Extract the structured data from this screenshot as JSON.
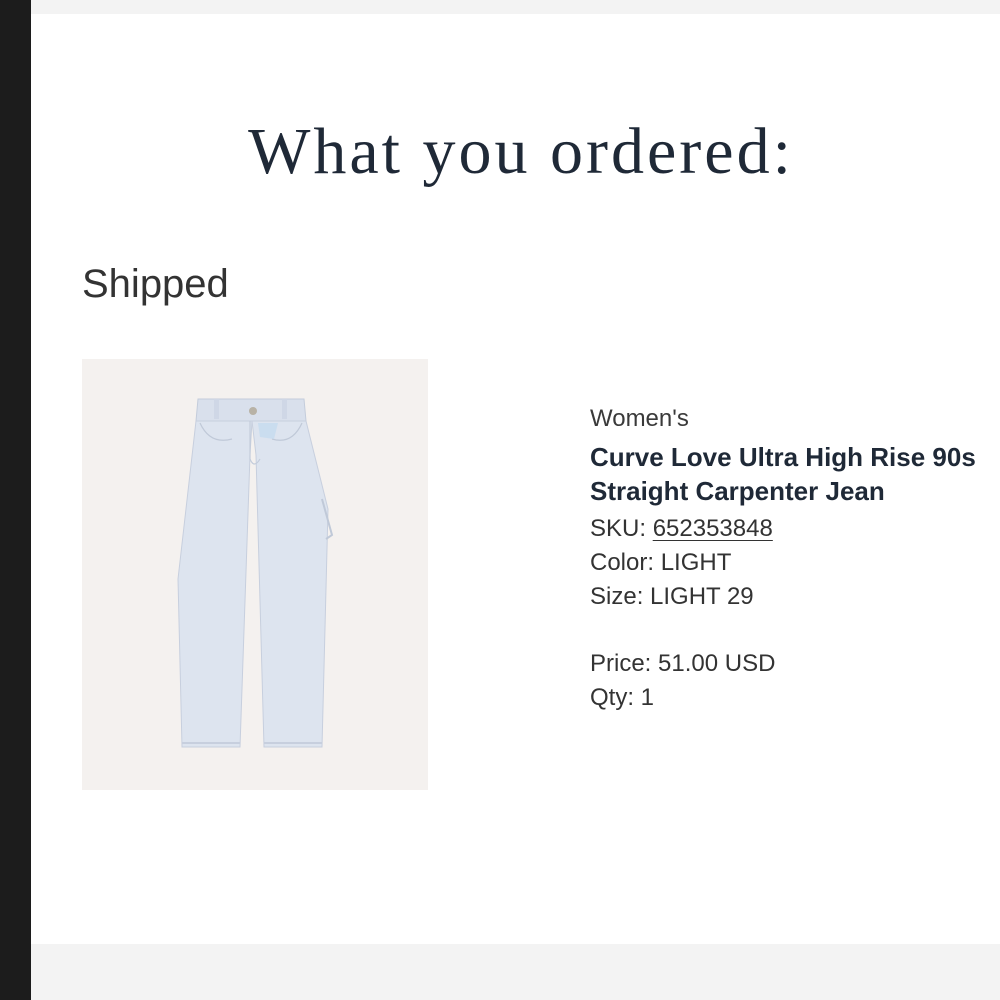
{
  "page": {
    "heading": "What you ordered:",
    "status": "Shipped"
  },
  "product": {
    "category": "Women's",
    "name": "Curve Love Ultra High Rise 90s Straight Carpenter Jean",
    "sku_label": "SKU: ",
    "sku_value": "652353848",
    "color_label": "Color: ",
    "color_value": "LIGHT",
    "size_label": "Size: ",
    "size_value": "LIGHT 29",
    "price_label": "Price: ",
    "price_value": "51.00 USD",
    "qty_label": "Qty: ",
    "qty_value": "1",
    "image_icon": "light-wash-jeans-image"
  },
  "colors": {
    "heading": "#1f2937",
    "sidebar": "#1c1c1c",
    "band": "#f3f3f3",
    "image_bg": "#f4f1ef",
    "denim": "#dde4ef"
  }
}
